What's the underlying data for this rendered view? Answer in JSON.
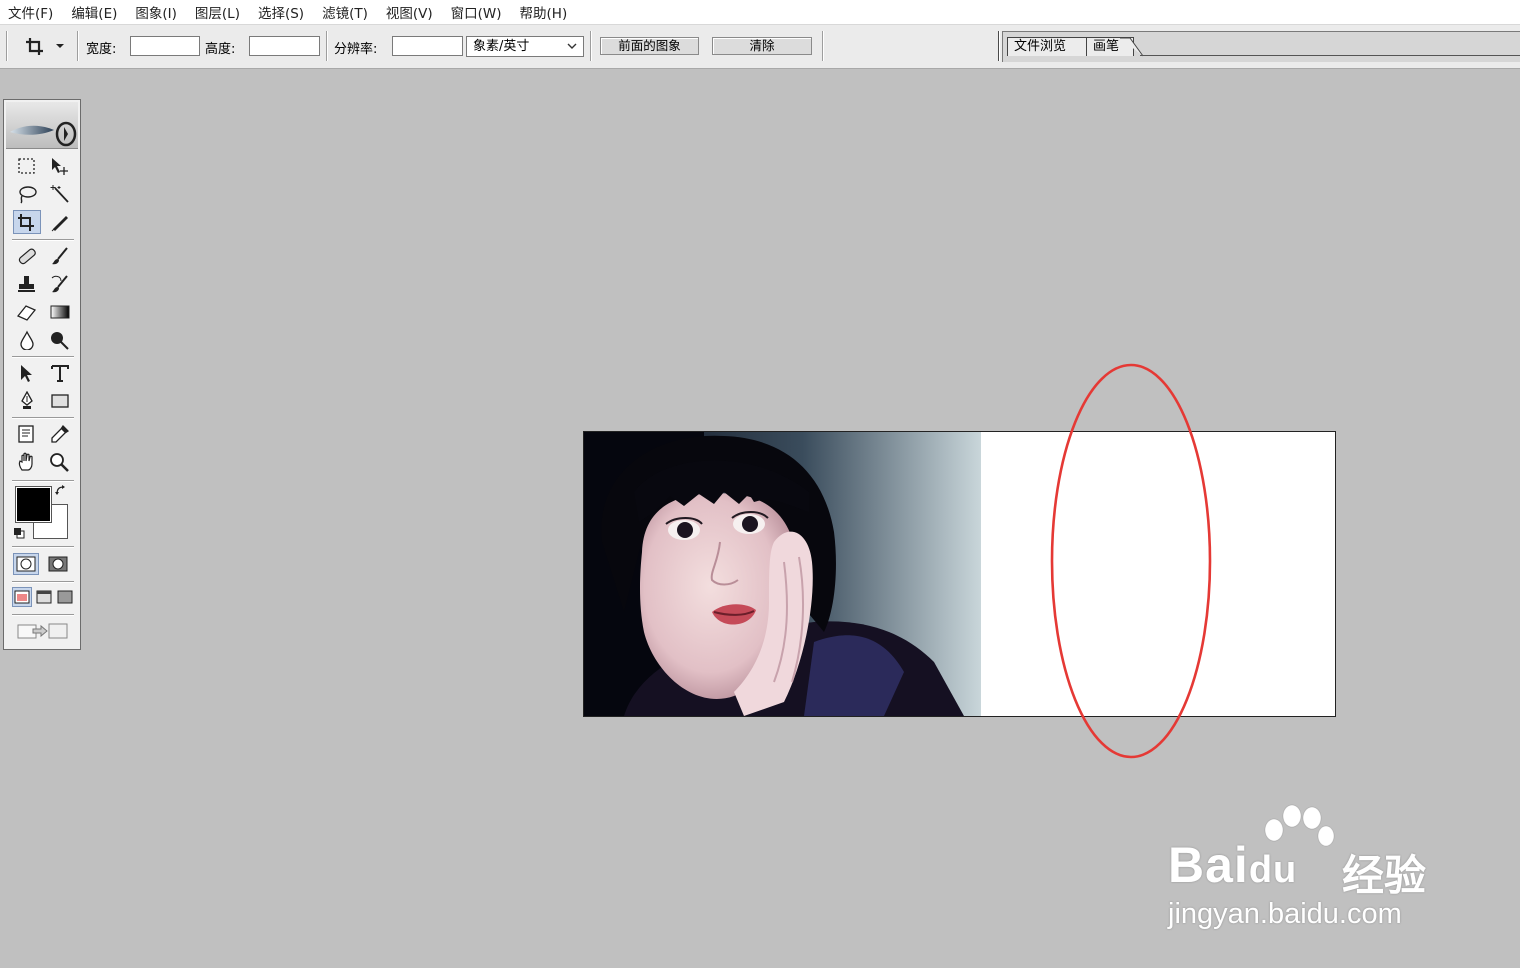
{
  "menu": [
    "文件(F)",
    "编辑(E)",
    "图象(I)",
    "图层(L)",
    "选择(S)",
    "滤镜(T)",
    "视图(V)",
    "窗口(W)",
    "帮助(H)"
  ],
  "options": {
    "width_label": "宽度:",
    "height_label": "高度:",
    "resolution_label": "分辨率:",
    "width_value": "",
    "height_value": "",
    "resolution_value": "",
    "unit_select": "象素/英寸",
    "front_image_button": "前面的图象",
    "clear_button": "清除"
  },
  "palette_tabs": [
    "文件浏览",
    "画笔"
  ],
  "toolbox": {
    "active_tool": "crop",
    "foreground_color": "#000000",
    "background_color": "#ffffff"
  },
  "annotation": {
    "shape": "ellipse",
    "color": "#e53935"
  },
  "watermark": {
    "brand": "Bai",
    "brand_suffix": "du",
    "product": "经验",
    "url": "jingyan.baidu.com"
  }
}
